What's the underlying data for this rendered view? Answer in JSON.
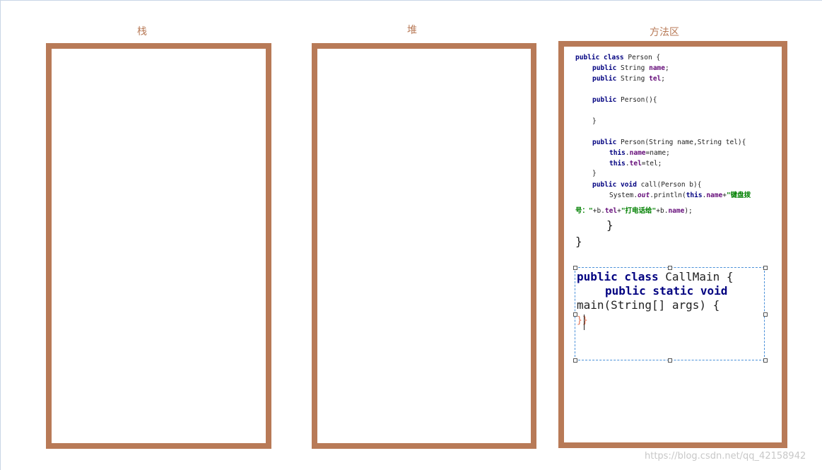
{
  "columns": {
    "stack": "栈",
    "heap": "堆",
    "method_area": "方法区"
  },
  "colors": {
    "frame": "#b87a57",
    "keyword": "#000080",
    "field": "#660e7a",
    "string": "#008000",
    "selection": "#4a90d9"
  },
  "person_class": {
    "l1_kw": "public class",
    "l1_name": " Person {",
    "l2_kw": "public",
    "l2_type": " String ",
    "l2_field": "name",
    "l2_end": ";",
    "l3_kw": "public",
    "l3_type": " String ",
    "l3_field": "tel",
    "l3_end": ";",
    "l4_kw": "public",
    "l4_rest": " Person(){",
    "l5": "}",
    "l6_kw": "public",
    "l6_rest": " Person(String name,String tel){",
    "l7_kw": "this",
    "l7_dot": ".",
    "l7_field": "name",
    "l7_rest": "=name;",
    "l8_kw": "this",
    "l8_dot": ".",
    "l8_field": "tel",
    "l8_rest": "=tel;",
    "l9": "}",
    "l10_kw": "public void",
    "l10_rest": " call(Person b){",
    "l11_a": "System.",
    "l11_out": "out",
    "l11_b": ".println(",
    "l11_this": "this",
    "l11_dot": ".",
    "l11_name": "name",
    "l11_plus": "+",
    "l11_str": "\"键盘拨",
    "l12_str": "号：\"",
    "l12_a": "+b.",
    "l12_tel": "tel",
    "l12_plus": "+",
    "l12_str2": "\"打电话给\"",
    "l12_b": "+b.",
    "l12_name": "name",
    "l12_end": ");",
    "close_method": "}",
    "close_class": "}"
  },
  "callmain": {
    "l1_kw": "public class",
    "l1_rest": " CallMain {",
    "l2_kw": "public static void",
    "l3": "main(String[] args) {",
    "l4": "}}"
  },
  "watermark": "https://blog.csdn.net/qq_42158942"
}
